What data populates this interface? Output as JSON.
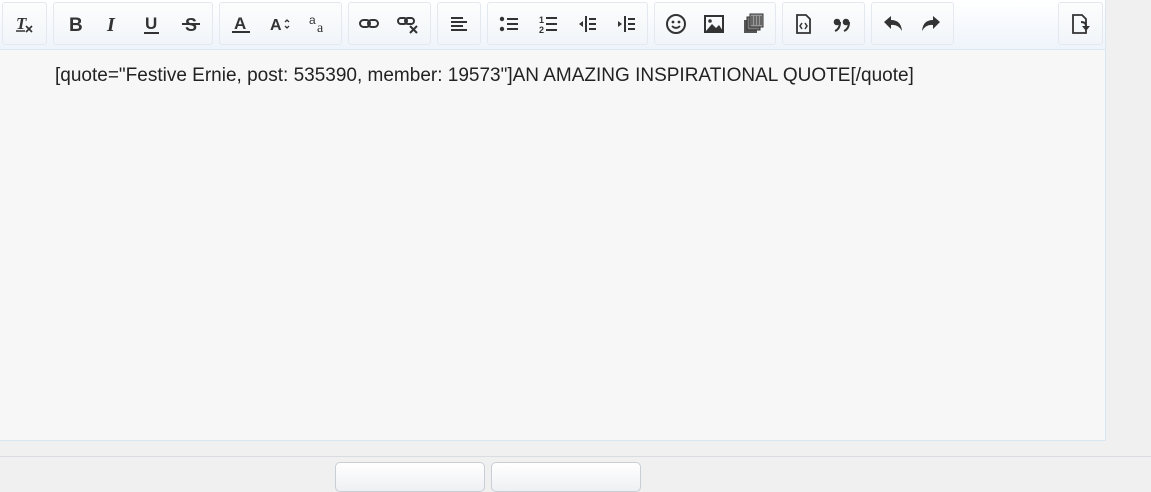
{
  "toolbar": {
    "groups": [
      {
        "name": "clear",
        "buttons": [
          "remove-format-icon"
        ]
      },
      {
        "name": "text-style",
        "buttons": [
          "bold-icon",
          "italic-icon",
          "underline-icon",
          "strikethrough-icon"
        ]
      },
      {
        "name": "font",
        "buttons": [
          "text-color-icon",
          "font-size-icon",
          "font-family-icon"
        ]
      },
      {
        "name": "link",
        "buttons": [
          "insert-link-icon",
          "remove-link-icon"
        ]
      },
      {
        "name": "align",
        "buttons": [
          "align-left-icon"
        ]
      },
      {
        "name": "lists",
        "buttons": [
          "bulleted-list-icon",
          "numbered-list-icon",
          "outdent-icon",
          "indent-icon"
        ]
      },
      {
        "name": "insert",
        "buttons": [
          "smilie-icon",
          "insert-image-icon",
          "media-icon"
        ]
      },
      {
        "name": "code",
        "buttons": [
          "code-icon",
          "quote-icon"
        ]
      },
      {
        "name": "history",
        "buttons": [
          "undo-icon",
          "redo-icon"
        ]
      },
      {
        "name": "mode",
        "buttons": [
          "toggle-bbcode-icon"
        ]
      }
    ]
  },
  "editor": {
    "content": "[quote=\"Festive Ernie, post: 535390, member: 19573\"]AN AMAZING INSPIRATIONAL QUOTE[/quote]"
  },
  "colors": {
    "toolbar_bg": "#f5f8fc",
    "editor_bg": "#f7f7f7",
    "icon": "#333333",
    "border": "#d8e6f4"
  }
}
